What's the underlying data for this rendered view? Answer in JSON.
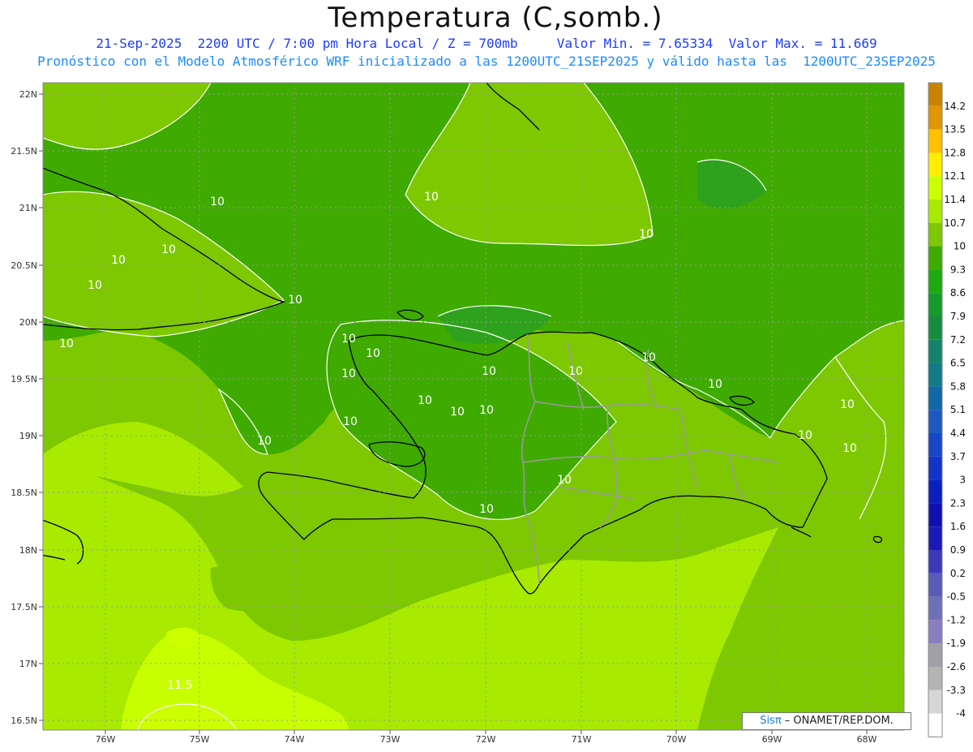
{
  "title": "Temperatura (C,somb.)",
  "subtitle_line1": "21-Sep-2025  2200 UTC / 7:00 pm Hora Local / Z = 700mb     Valor Min. = 7.65334  Valor Max. = 11.669",
  "subtitle_line2": "Pronóstico con el Modelo Atmosférico WRF inicializado a las 1200UTC_21SEP2025 y válido hasta las  1200UTC_23SEP2025",
  "credit": {
    "brand": "Sisπ",
    "text": " – ONAMET/REP.DOM."
  },
  "map": {
    "lat_ticks": [
      "22N",
      "21.5N",
      "21N",
      "20.5N",
      "20N",
      "19.5N",
      "19N",
      "18.5N",
      "18N",
      "17.5N",
      "17N",
      "16.5N"
    ],
    "lon_ticks": [
      "76W",
      "75W",
      "74W",
      "73W",
      "72W",
      "71W",
      "70W",
      "69W",
      "68W"
    ],
    "contour_labels": [
      "10",
      "10",
      "10",
      "10",
      "10",
      "10",
      "10",
      "10",
      "10",
      "10",
      "10",
      "10",
      "10",
      "10",
      "10",
      "10",
      "10",
      "10",
      "10",
      "10",
      "10",
      "10",
      "10",
      "10",
      "10",
      "11.5"
    ]
  },
  "colorbar": {
    "labels": [
      "14.2",
      "13.5",
      "12.8",
      "12.1",
      "11.4",
      "10.7",
      "10",
      "9.3",
      "8.6",
      "7.9",
      "7.2",
      "6.5",
      "5.8",
      "5.1",
      "4.4",
      "3.7",
      "3",
      "2.3",
      "1.6",
      "0.9",
      "0.2",
      "-0.5",
      "-1.2",
      "-1.9",
      "-2.6",
      "-3.3",
      "-4"
    ],
    "colors": [
      "#c88200",
      "#e09600",
      "#ffc000",
      "#ffee00",
      "#ccff00",
      "#a8ea00",
      "#7dc800",
      "#3faa00",
      "#1ea812",
      "#169a2c",
      "#178c40",
      "#17826a",
      "#137a88",
      "#1268a4",
      "#1e59c0",
      "#1846c8",
      "#1234c8",
      "#0a1fc0",
      "#1010b0",
      "#1a1ab8",
      "#3a3ab8",
      "#5a5ab8",
      "#7070b8",
      "#8a7ec0",
      "#a0a0a8",
      "#b4b4b4",
      "#d6d6d6",
      "#ffffff"
    ]
  }
}
